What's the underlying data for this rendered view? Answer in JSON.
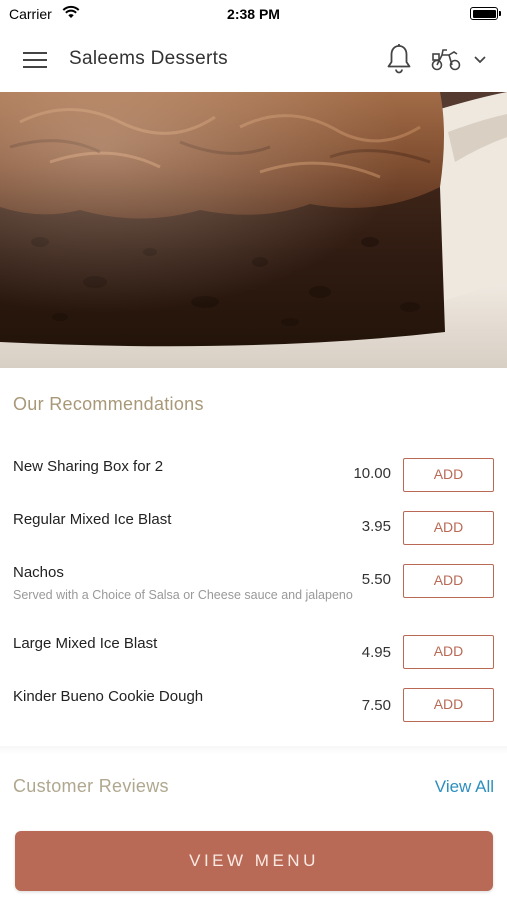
{
  "status_bar": {
    "carrier": "Carrier",
    "time": "2:38 PM"
  },
  "header": {
    "title": "Saleems Desserts",
    "icons": [
      "menu-icon",
      "bell-icon",
      "delivery-scooter-icon",
      "chevron-down-icon"
    ]
  },
  "hero": {
    "image": "chocolate-cake-photo"
  },
  "recommendations": {
    "title": "Our Recommendations",
    "add_label": "ADD",
    "items": [
      {
        "name": "New Sharing Box for 2",
        "description": "",
        "price": "10.00"
      },
      {
        "name": "Regular Mixed Ice Blast",
        "description": "",
        "price": "3.95"
      },
      {
        "name": "Nachos",
        "description": "Served with a Choice of Salsa or Cheese sauce and jalapeno",
        "price": "5.50"
      },
      {
        "name": "Large Mixed Ice Blast",
        "description": "",
        "price": "4.95"
      },
      {
        "name": "Kinder Bueno Cookie Dough",
        "description": "",
        "price": "7.50"
      }
    ]
  },
  "reviews": {
    "title": "Customer Reviews",
    "view_all": "View All"
  },
  "footer": {
    "view_menu": "VIEW MENU"
  },
  "colors": {
    "accent": "#b96a56",
    "section_title": "#a89878",
    "link": "#2d8fbf"
  }
}
